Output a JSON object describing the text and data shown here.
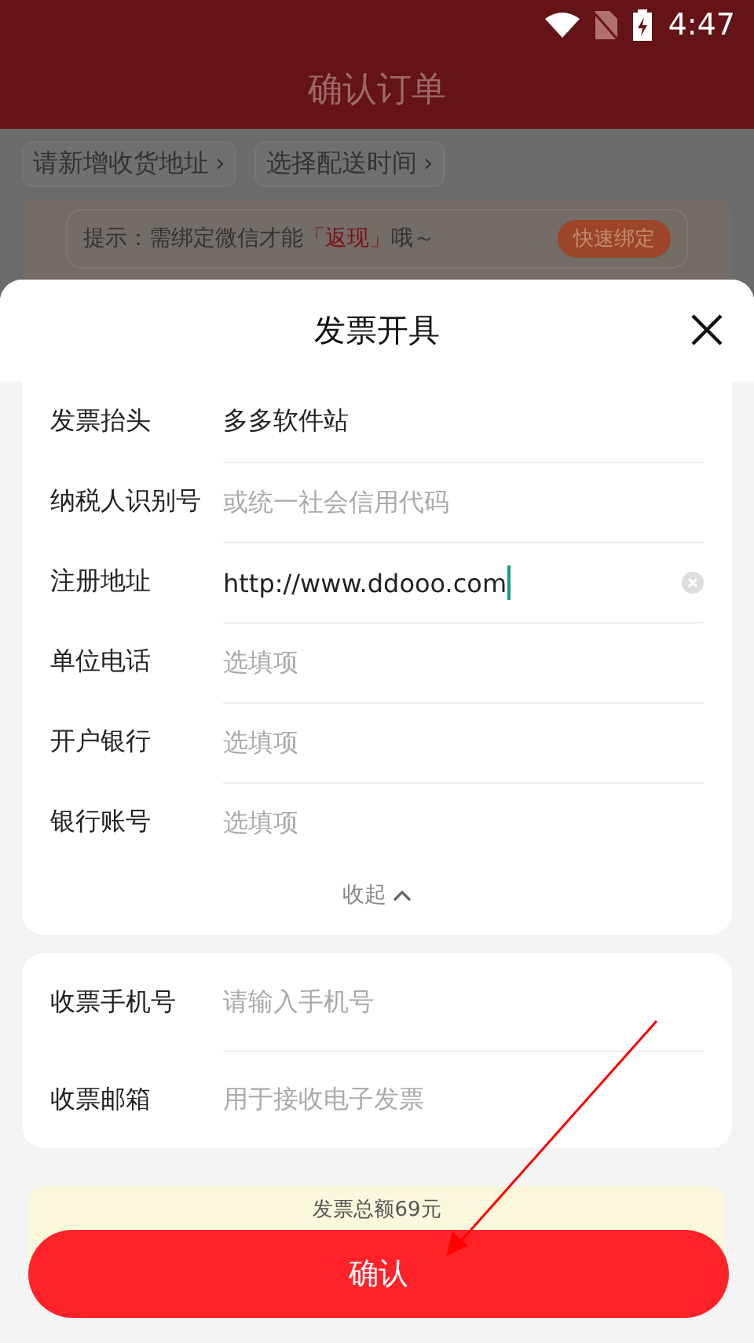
{
  "status_bar": {
    "time": "4:47"
  },
  "header": {
    "title": "确认订单"
  },
  "chips": [
    {
      "label": "请新增收货地址",
      "arrow": "›"
    },
    {
      "label": "选择配送时间",
      "arrow": "›"
    }
  ],
  "hint": {
    "text": "提示：需绑定微信才能",
    "highlight": "「返现」",
    "suffix": "哦～",
    "button": "快速绑定"
  },
  "sheet": {
    "title": "发票开具",
    "fields": [
      {
        "label": "发票抬头",
        "value": "多多软件站",
        "focused": false
      },
      {
        "label": "纳税人识别号",
        "placeholder": "或统一社会信用代码",
        "focused": false
      },
      {
        "label": "注册地址",
        "value": "http://www.ddooo.com",
        "focused": true
      },
      {
        "label": "单位电话",
        "placeholder": "选填项",
        "focused": false
      },
      {
        "label": "开户银行",
        "placeholder": "选填项",
        "focused": false
      },
      {
        "label": "银行账号",
        "placeholder": "选填项",
        "focused": false
      }
    ],
    "collapse": "收起",
    "contact_fields": [
      {
        "label": "收票手机号",
        "placeholder": "请输入手机号",
        "focused": false
      },
      {
        "label": "收票邮箱",
        "placeholder": "用于接收电子发票",
        "focused": false
      }
    ],
    "total": "发票总额69元",
    "confirm": "确认"
  }
}
